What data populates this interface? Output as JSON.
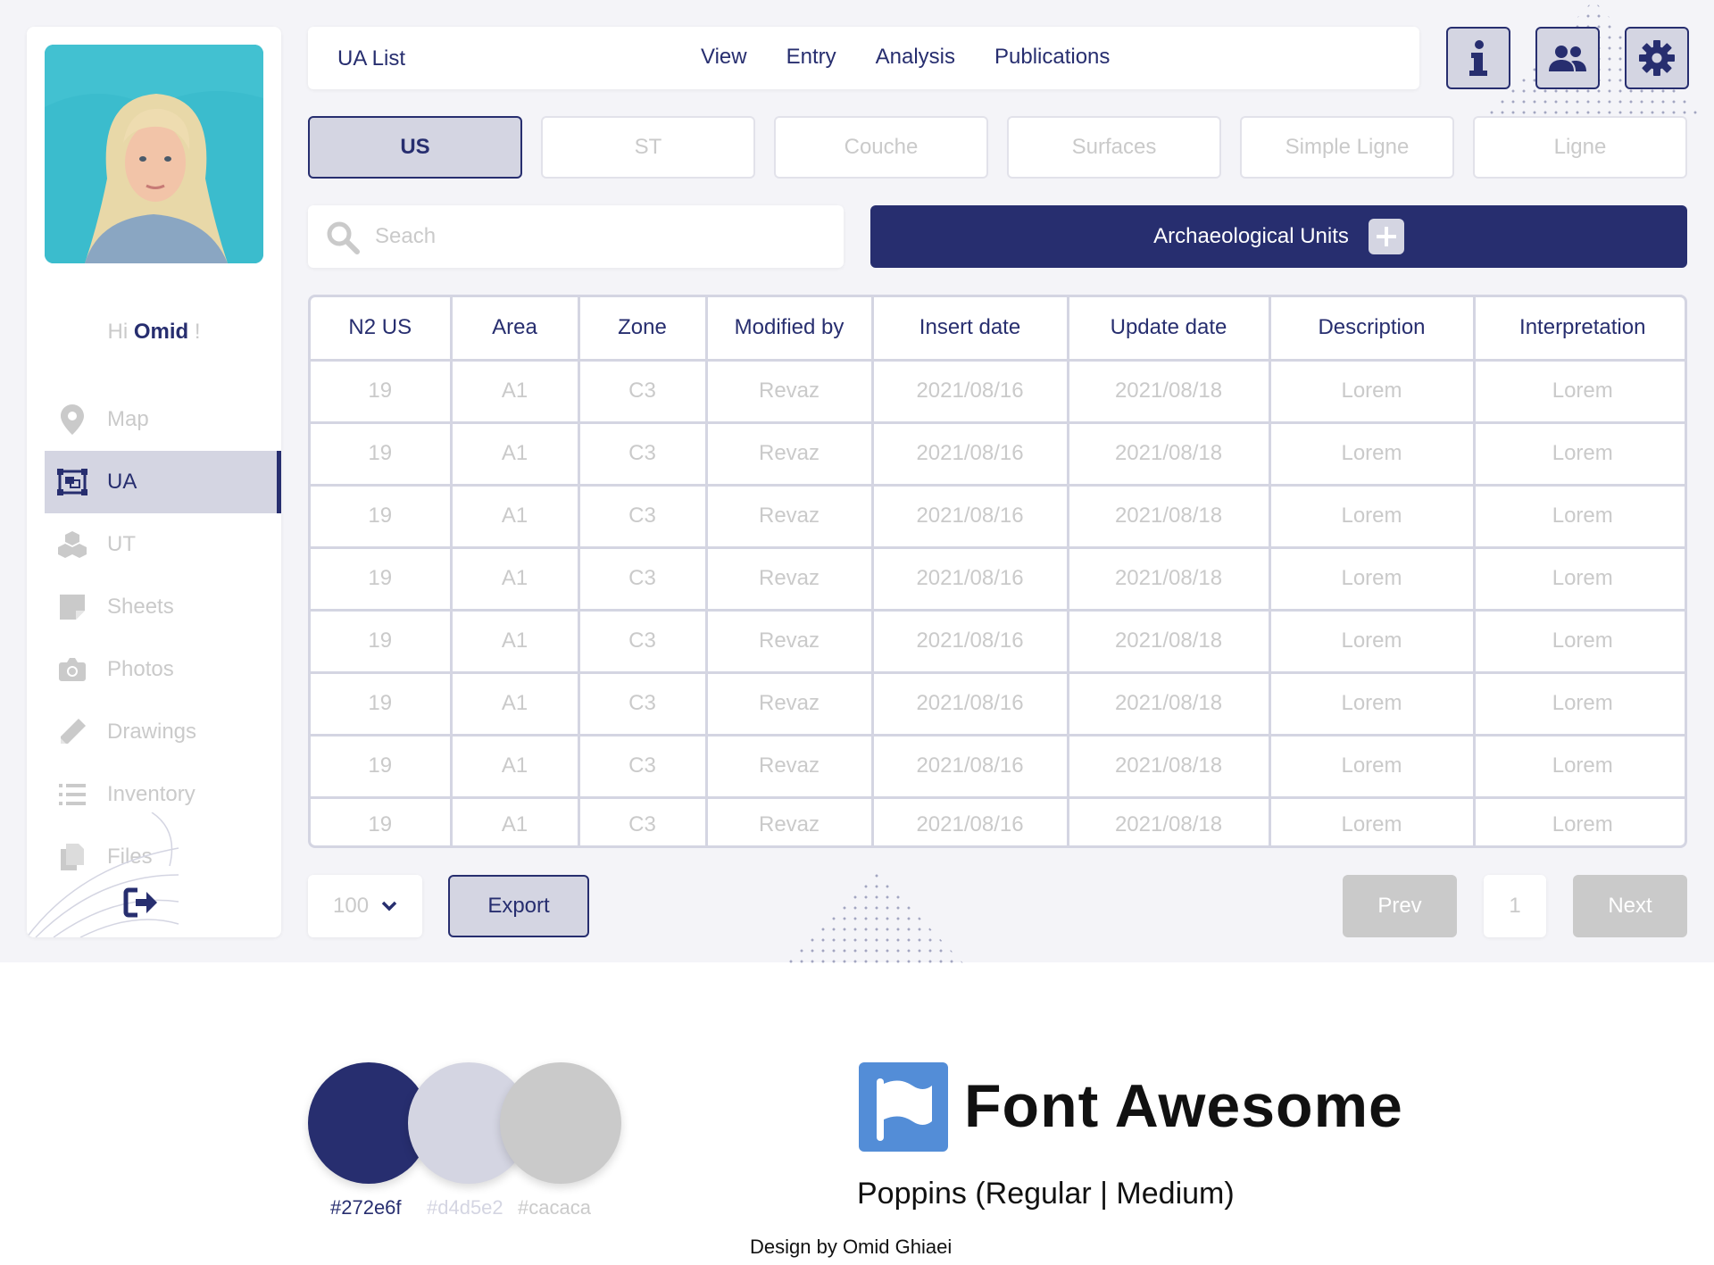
{
  "sidebar": {
    "greeting_prefix": "Hi",
    "user_name": "Omid",
    "greeting_suffix": "!",
    "items": [
      {
        "label": "Map",
        "icon": "map-marker-icon",
        "active": false
      },
      {
        "label": "UA",
        "icon": "object-group-icon",
        "active": true
      },
      {
        "label": "UT",
        "icon": "cubes-icon",
        "active": false
      },
      {
        "label": "Sheets",
        "icon": "sticky-note-icon",
        "active": false
      },
      {
        "label": "Photos",
        "icon": "camera-icon",
        "active": false
      },
      {
        "label": "Drawings",
        "icon": "pencil-icon",
        "active": false
      },
      {
        "label": "Inventory",
        "icon": "list-icon",
        "active": false
      },
      {
        "label": "Files",
        "icon": "copy-icon",
        "active": false
      }
    ],
    "logout_icon": "sign-out-icon"
  },
  "header": {
    "title": "UA List",
    "menu": [
      "View",
      "Entry",
      "Analysis",
      "Publications"
    ],
    "icons": [
      "info-icon",
      "users-icon",
      "gear-icon"
    ]
  },
  "tabs": [
    "US",
    "ST",
    "Couche",
    "Surfaces",
    "Simple Ligne",
    "Ligne"
  ],
  "active_tab": "US",
  "search": {
    "placeholder": "Seach",
    "value": ""
  },
  "add_button": {
    "label": "Archaeological Units"
  },
  "table": {
    "columns": [
      "N2 US",
      "Area",
      "Zone",
      "Modified by",
      "Insert date",
      "Update date",
      "Description",
      "Interpretation"
    ],
    "rows": [
      [
        "19",
        "A1",
        "C3",
        "Revaz",
        "2021/08/16",
        "2021/08/18",
        "Lorem",
        "Lorem"
      ],
      [
        "19",
        "A1",
        "C3",
        "Revaz",
        "2021/08/16",
        "2021/08/18",
        "Lorem",
        "Lorem"
      ],
      [
        "19",
        "A1",
        "C3",
        "Revaz",
        "2021/08/16",
        "2021/08/18",
        "Lorem",
        "Lorem"
      ],
      [
        "19",
        "A1",
        "C3",
        "Revaz",
        "2021/08/16",
        "2021/08/18",
        "Lorem",
        "Lorem"
      ],
      [
        "19",
        "A1",
        "C3",
        "Revaz",
        "2021/08/16",
        "2021/08/18",
        "Lorem",
        "Lorem"
      ],
      [
        "19",
        "A1",
        "C3",
        "Revaz",
        "2021/08/16",
        "2021/08/18",
        "Lorem",
        "Lorem"
      ],
      [
        "19",
        "A1",
        "C3",
        "Revaz",
        "2021/08/16",
        "2021/08/18",
        "Lorem",
        "Lorem"
      ],
      [
        "19",
        "A1",
        "C3",
        "Revaz",
        "2021/08/16",
        "2021/08/18",
        "Lorem",
        "Lorem"
      ]
    ]
  },
  "footer": {
    "per_page": "100",
    "export_label": "Export",
    "prev_label": "Prev",
    "page": "1",
    "next_label": "Next"
  },
  "style_guide": {
    "colors": [
      "#272e6f",
      "#d4d5e2",
      "#cacaca"
    ],
    "icon_library": "Font Awesome",
    "fonts": "Poppins (Regular | Medium)",
    "credit": "Design by Omid Ghiaei"
  }
}
